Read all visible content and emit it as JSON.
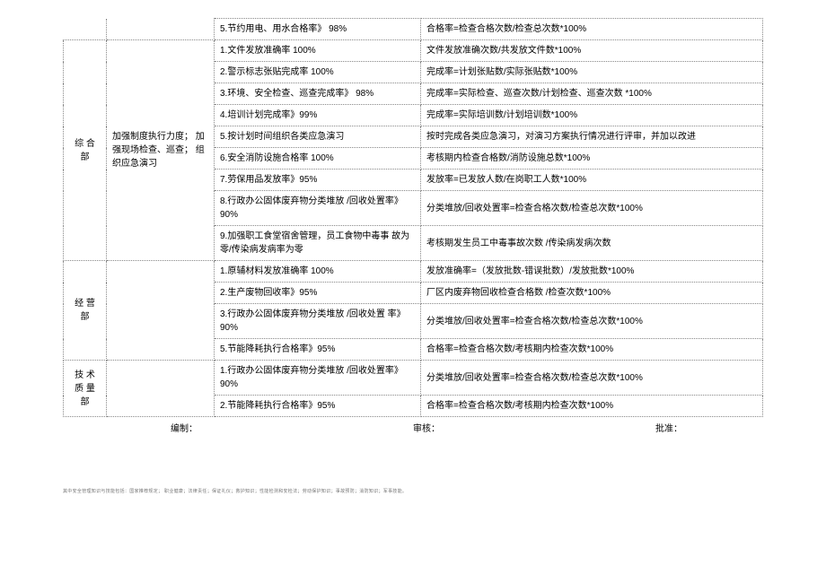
{
  "topRow": {
    "metric": "5.节约用电、用水合格率》 98%",
    "formula": "合格率=检查合格次数/检查总次数*100%"
  },
  "sections": [
    {
      "dept": "综 合  部",
      "desc": "加强制度执行力度； 加强现场检查、巡查； 组织应急演习",
      "rows": [
        {
          "metric": "1.文件发放准确率 100%",
          "formula": "文件发放准确次数/共发放文件数*100%"
        },
        {
          "metric": "2.警示标志张贴完成率 100%",
          "formula": "完成率=计划张贴数/实际张贴数*100%"
        },
        {
          "metric": "3.环境、安全检查、巡查完成率》   98%",
          "formula": "完成率=实际检查、巡查次数/计划检查、巡查次数 *100%"
        },
        {
          "metric": "4.培训计划完成率》99%",
          "formula": "完成率=实际培训数/计划培训数*100%"
        },
        {
          "metric": "5.按计划时间组织各类应急演习",
          "formula": "按时完成各类应急演习，对演习方案执行情况进行评审，并加以改进"
        },
        {
          "metric": "6.安全消防设施合格率 100%",
          "formula": "考核期内检查合格数/消防设施总数*100%"
        },
        {
          "metric": "7.劳保用品发放率》95%",
          "formula": "发放率=已发放人数/在岗职工人数*100%"
        },
        {
          "metric": "8.行政办公固体废弃物分类堆放 /回收处置率》90%",
          "formula": "分类堆放/回收处置率=检查合格次数/检查总次数*100%"
        },
        {
          "metric": "9.加强职工食堂宿舍管理，员工食物中毒事 故为零/传染病发病率为零",
          "formula": "考核期发生员工中毒事故次数 /传染病发病次数"
        }
      ]
    },
    {
      "dept": "经 营  部",
      "desc": "",
      "rows": [
        {
          "metric": "1.原辅材料发放准确率 100%",
          "formula": "发放准确率=（发放批数-错误批数）/发放批数*100%"
        },
        {
          "metric": "2.生产废物回收率》95%",
          "formula": "厂区内废弃物回收检查合格数    /检查次数*100%"
        },
        {
          "metric": "3.行政办公固体废弃物分类堆放 /回收处置 率》90%",
          "formula": "分类堆放/回收处置率=检查合格次数/检查总次数*100%"
        },
        {
          "metric": "5.节能降耗执行合格率》95%",
          "formula": "合格率=检查合格次数/考核期内检查次数*100%"
        }
      ]
    },
    {
      "dept": "技 术  质 量 部",
      "desc": "",
      "rows": [
        {
          "metric": "1.行政办公固体废弃物分类堆放    /回收处置率》90%",
          "formula": "分类堆放/回收处置率=检查合格次数/检查总次数*100%"
        },
        {
          "metric": "2.节能降耗执行合格率》95%",
          "formula": "合格率=检查合格次数/考核期内检查次数*100%"
        }
      ]
    }
  ],
  "footer": {
    "compile": "编制：",
    "review": "审核：",
    "approve": "批准："
  },
  "tiny": "其中安全管理知识与技能包括：国家推荐规定；  职业健康；法律责任；保证礼仪；救护知识；性能检测和安检法；劳动保护知识；事故预防；消防知识；军事技能。"
}
